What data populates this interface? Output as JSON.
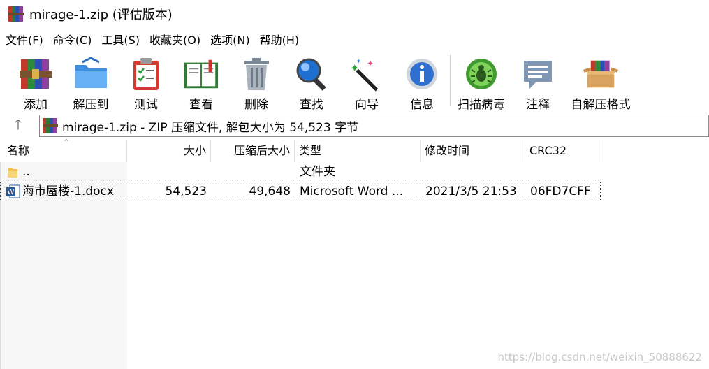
{
  "window": {
    "title": "mirage-1.zip (评估版本)",
    "icon": "winrar-books-icon"
  },
  "menu": [
    "文件(F)",
    "命令(C)",
    "工具(S)",
    "收藏夹(O)",
    "选项(N)",
    "帮助(H)"
  ],
  "toolbar": [
    {
      "label": "添加",
      "icon": "add-archive-icon"
    },
    {
      "label": "解压到",
      "icon": "extract-folder-icon"
    },
    {
      "label": "测试",
      "icon": "test-clipboard-icon"
    },
    {
      "label": "查看",
      "icon": "view-book-icon"
    },
    {
      "label": "删除",
      "icon": "trash-icon"
    },
    {
      "label": "查找",
      "icon": "magnifier-icon"
    },
    {
      "label": "向导",
      "icon": "wizard-wand-icon"
    },
    {
      "label": "信息",
      "icon": "info-icon"
    },
    {
      "label": "扫描病毒",
      "icon": "virus-scan-icon"
    },
    {
      "label": "注释",
      "icon": "comment-icon"
    },
    {
      "label": "自解压格式",
      "icon": "sfx-box-icon"
    }
  ],
  "address": {
    "text": "mirage-1.zip - ZIP 压缩文件, 解包大小为 54,523 字节"
  },
  "columns": [
    "名称",
    "大小",
    "压缩后大小",
    "类型",
    "修改时间",
    "CRC32"
  ],
  "rows": [
    {
      "name": "..",
      "size": "",
      "packed": "",
      "type": "文件夹",
      "modified": "",
      "crc": "",
      "icon": "folder-icon"
    },
    {
      "name": "海市蜃楼-1.docx",
      "size": "54,523",
      "packed": "49,648",
      "type": "Microsoft Word ...",
      "modified": "2021/3/5 21:53",
      "crc": "06FD7CFF",
      "icon": "word-doc-icon"
    }
  ],
  "watermark": "https://blog.csdn.net/weixin_50888622"
}
